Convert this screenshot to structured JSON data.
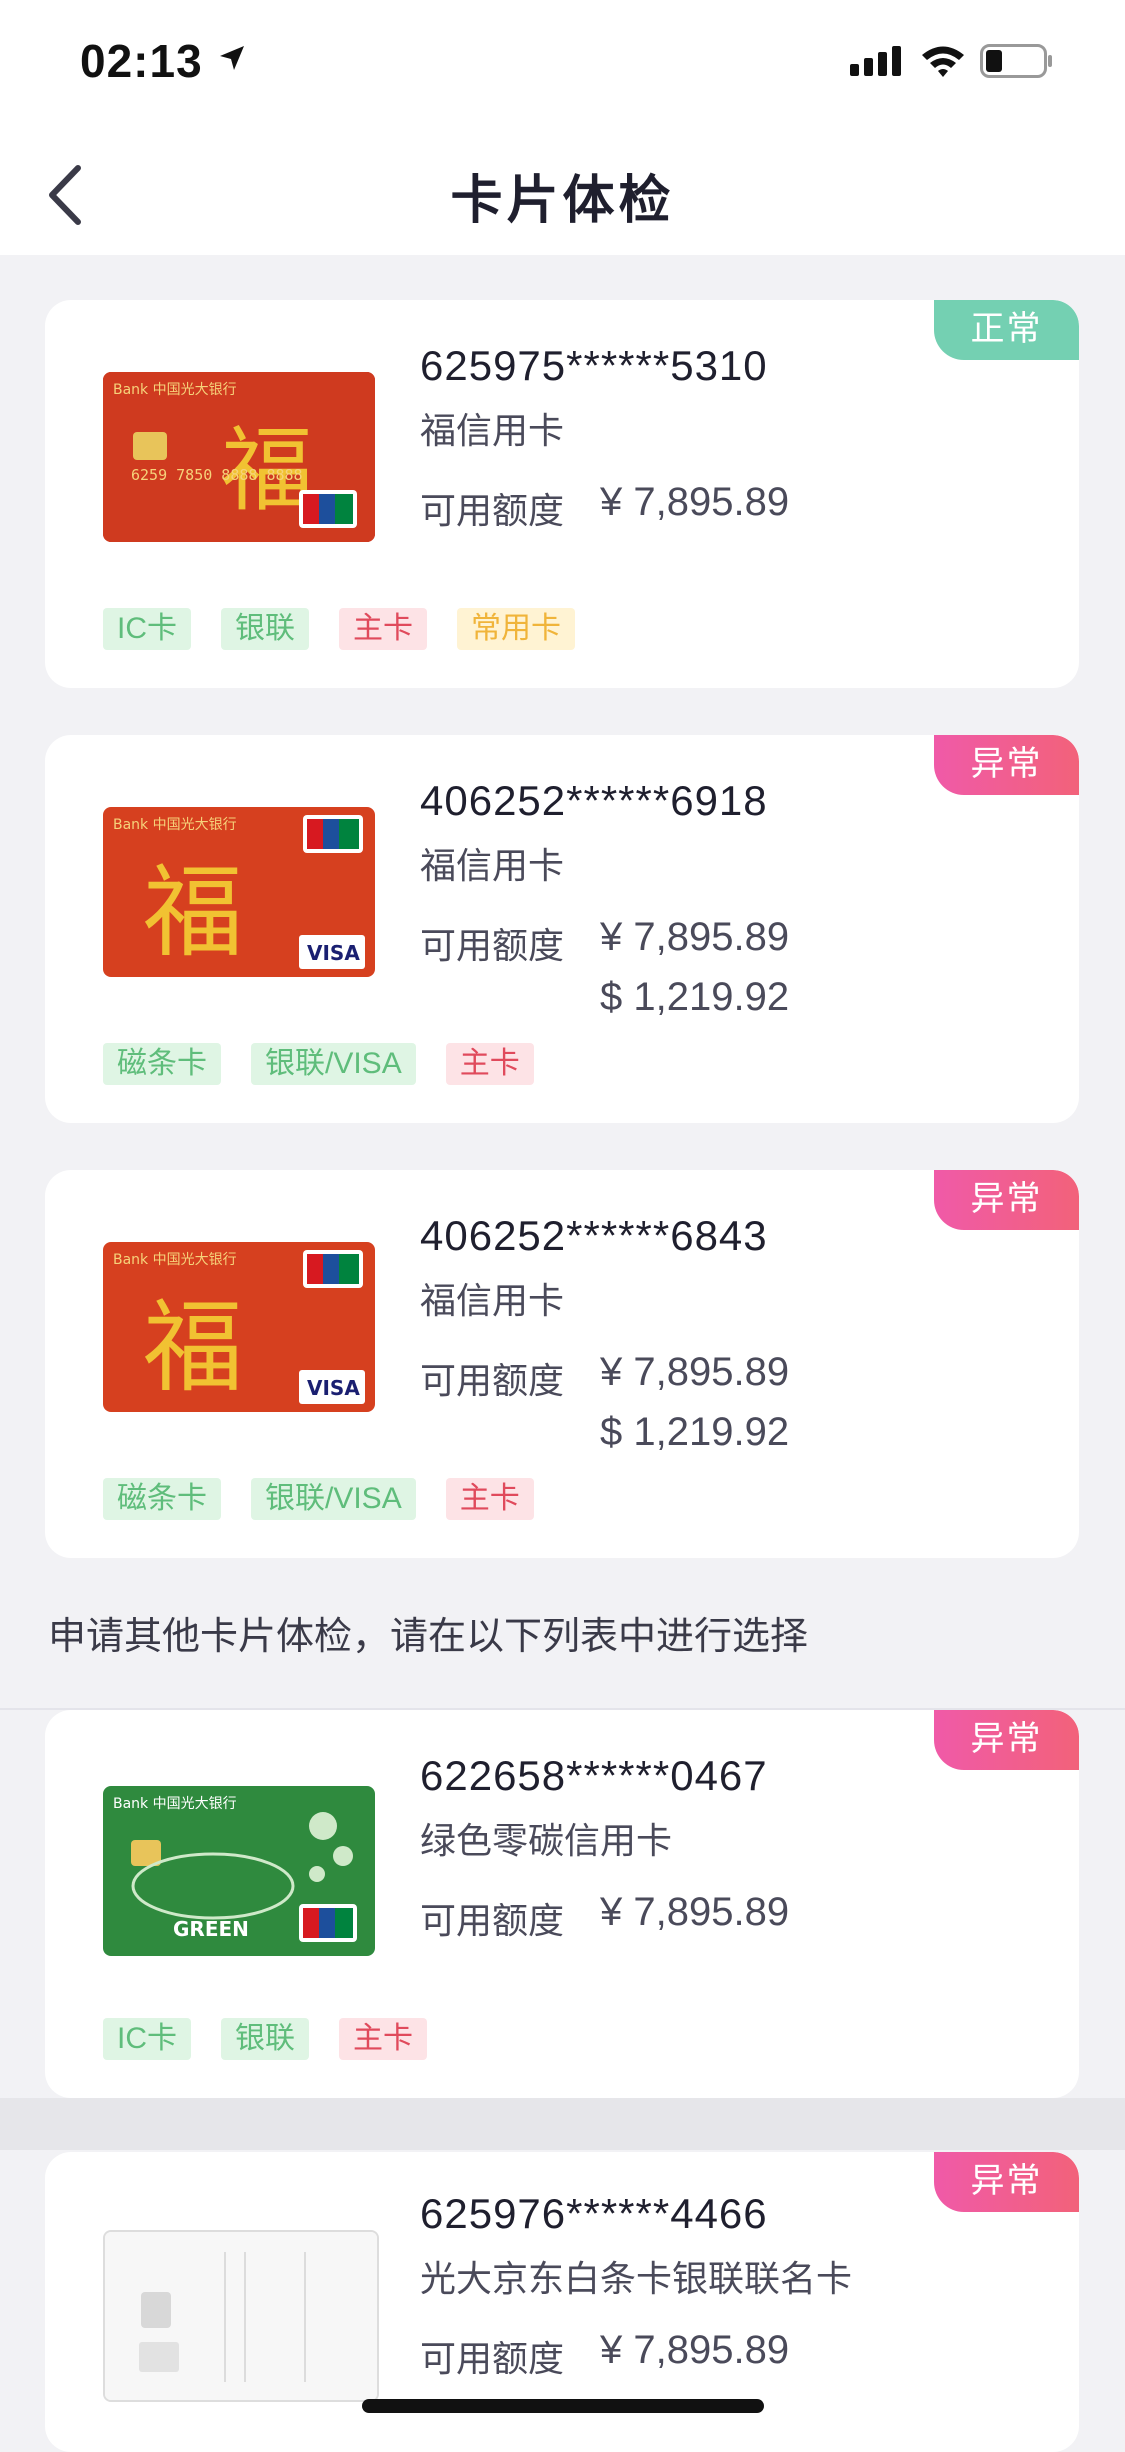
{
  "status": {
    "time": "02:13"
  },
  "nav": {
    "title": "卡片体检"
  },
  "cards": [
    {
      "number": "625975******5310",
      "name": "福信用卡",
      "limit_label": "可用额度",
      "limit_cny": "¥ 7,895.89",
      "badge": "正常",
      "tags": [
        "IC卡",
        "银联",
        "主卡",
        "常用卡"
      ]
    },
    {
      "number": "406252******6918",
      "name": "福信用卡",
      "limit_label": "可用额度",
      "limit_cny": "¥ 7,895.89",
      "limit_usd": "$ 1,219.92",
      "badge": "异常",
      "tags": [
        "磁条卡",
        "银联/VISA",
        "主卡"
      ]
    },
    {
      "number": "406252******6843",
      "name": "福信用卡",
      "limit_label": "可用额度",
      "limit_cny": "¥ 7,895.89",
      "limit_usd": "$ 1,219.92",
      "badge": "异常",
      "tags": [
        "磁条卡",
        "银联/VISA",
        "主卡"
      ]
    }
  ],
  "section_label": "申请其他卡片体检，请在以下列表中进行选择",
  "other_cards": [
    {
      "number": "622658******0467",
      "name": "绿色零碳信用卡",
      "limit_label": "可用额度",
      "limit_cny": "¥ 7,895.89",
      "badge": "异常",
      "tags": [
        "IC卡",
        "银联",
        "主卡"
      ]
    },
    {
      "number": "625976******4466",
      "name": "光大京东白条卡银联联名卡",
      "limit_label": "可用额度",
      "limit_cny": "¥ 7,895.89",
      "badge": "异常"
    }
  ],
  "card_art": {
    "fu_text": "福",
    "bank_text": "Bank 中国光大银行",
    "unionpay_text": "UnionPay",
    "visa_text": "VISA",
    "green_text": "GREEN",
    "fu_card_number": "6259 7850 8888 8888"
  },
  "colors": {
    "normal_badge": "#74d0b2",
    "abnormal_badge": "#f05aa8",
    "tag_green": "#5fbd7b",
    "tag_red": "#e04a5c",
    "tag_yellow": "#f0b43a"
  }
}
